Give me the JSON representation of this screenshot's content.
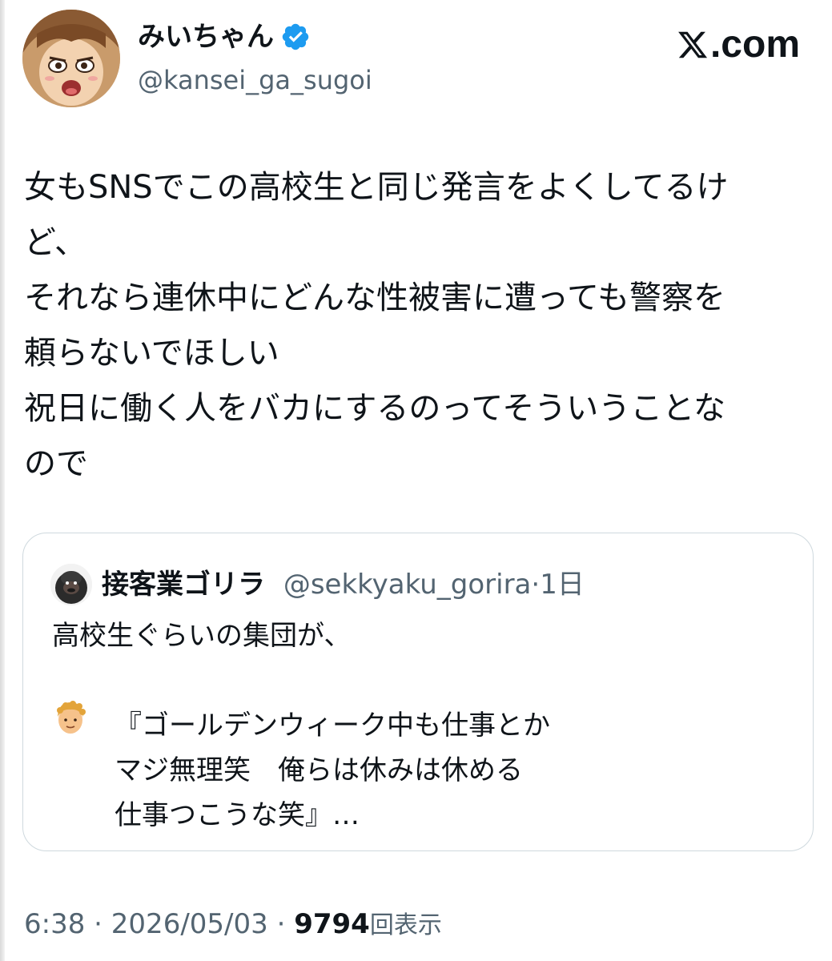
{
  "author": {
    "display_name": "みいちゃん",
    "handle": "@kansei_ga_sugoi",
    "verified": true,
    "avatar_icon": "anime-character-avatar"
  },
  "brand": {
    "text": ".com",
    "logo_icon": "x-logo-icon"
  },
  "tweet": {
    "lines": [
      "女もSNSでこの高校生と同じ発言をよくしてるけ",
      "ど、",
      "それなら連休中にどんな性被害に遭っても警察を",
      "頼らないでほしい",
      "祝日に働く人をバカにするのってそういうことな",
      "ので"
    ]
  },
  "quoted": {
    "display_name": "接客業ゴリラ",
    "handle": "@sekkyaku_gorira",
    "separator": "·",
    "time_ago": "1日",
    "avatar_icon": "gorilla-avatar",
    "emoji_icon": "person-emoji-icon",
    "lines": [
      "高校生ぐらいの集団が、",
      "『ゴールデンウィーク中も仕事とか",
      "マジ無理笑　俺らは休みは休める",
      "仕事つこうな笑』…"
    ]
  },
  "footer": {
    "time": "6:38",
    "sep1": "·",
    "date": "2026/05/03",
    "sep2": "·",
    "views_count": "9794",
    "views_label": "回表示"
  },
  "colors": {
    "text": "#0f1419",
    "secondary": "#536471",
    "border": "#cfd9de",
    "verified": "#1d9bf0"
  }
}
